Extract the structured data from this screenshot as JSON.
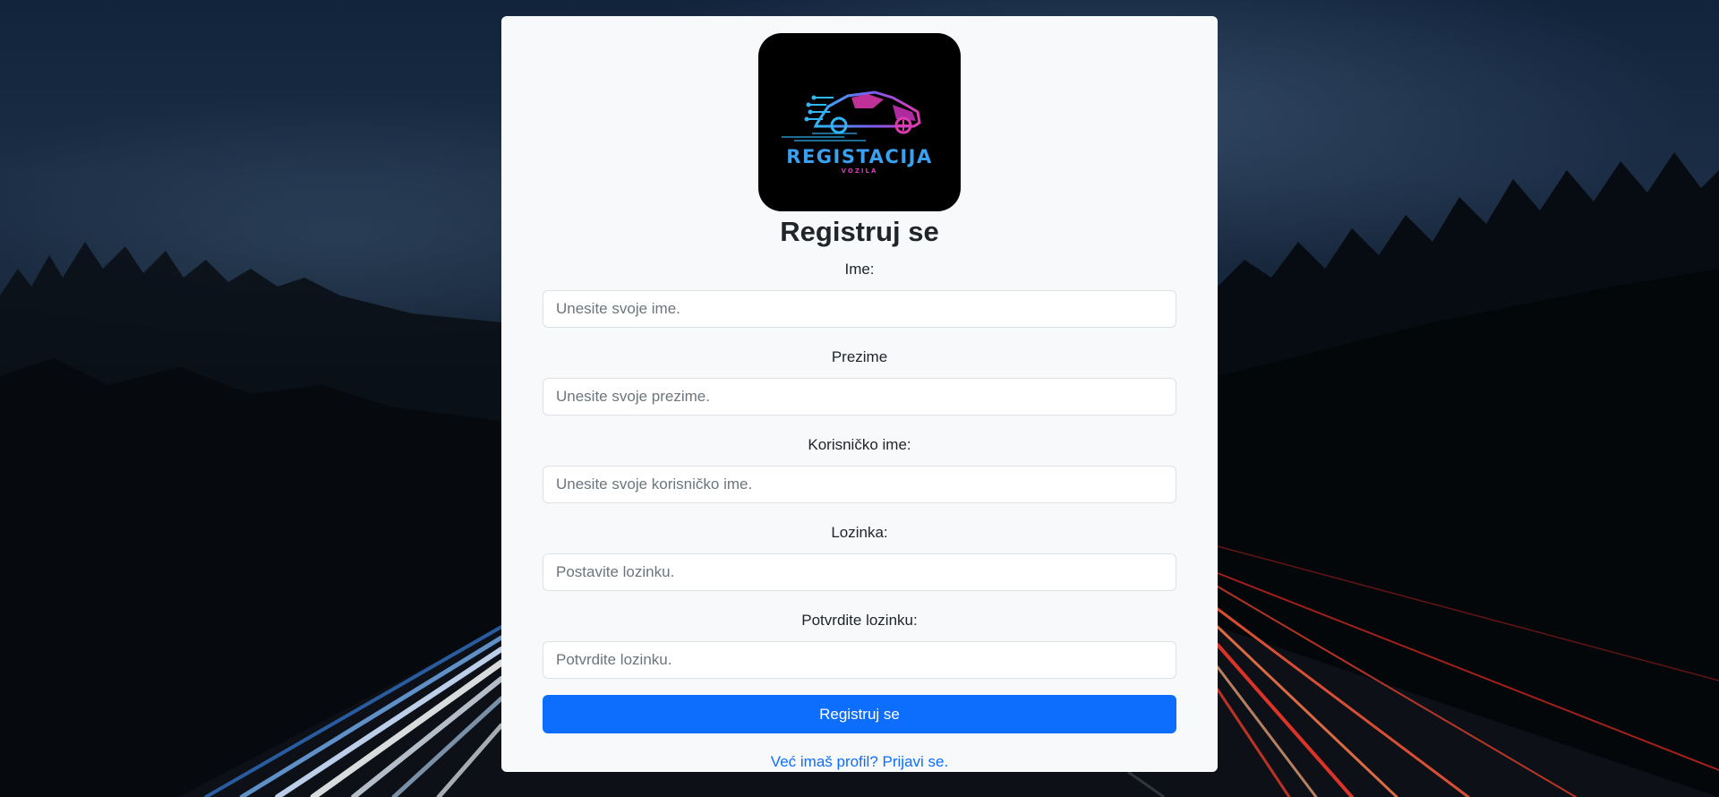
{
  "logo": {
    "title": "REGISTACIJA",
    "subtitle": "VOZILA",
    "icon": "car-circuit-icon",
    "colors": {
      "blue": "#3aa0f0",
      "magenta": "#d63ab8",
      "background": "#000000"
    }
  },
  "page": {
    "title": "Registruj se"
  },
  "form": {
    "fields": [
      {
        "label": "Ime:",
        "placeholder": "Unesite svoje ime.",
        "type": "text"
      },
      {
        "label": "Prezime",
        "placeholder": "Unesite svoje prezime.",
        "type": "text"
      },
      {
        "label": "Korisničko ime:",
        "placeholder": "Unesite svoje korisničko ime.",
        "type": "text"
      },
      {
        "label": "Lozinka:",
        "placeholder": "Postavite lozinku.",
        "type": "password"
      },
      {
        "label": "Potvrdite lozinku:",
        "placeholder": "Potvrdite lozinku.",
        "type": "password"
      }
    ],
    "submit_label": "Registruj se",
    "login_link": "Već imaš profil? Prijavi se."
  },
  "colors": {
    "primary": "#0d6efd",
    "card_background": "#f8f9fa",
    "text": "#212529",
    "placeholder": "#6c757d"
  }
}
